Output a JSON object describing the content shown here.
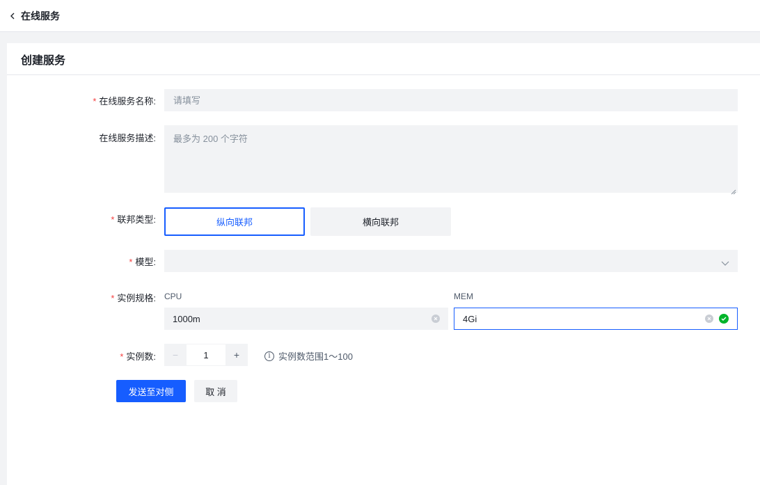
{
  "header": {
    "back_label": "在线服务"
  },
  "card": {
    "title": "创建服务"
  },
  "form": {
    "name": {
      "label": "在线服务名称:",
      "required": true,
      "placeholder": "请填写",
      "value": ""
    },
    "description": {
      "label": "在线服务描述:",
      "required": false,
      "placeholder": "最多为 200 个字符",
      "value": ""
    },
    "federation_type": {
      "label": "联邦类型:",
      "required": true,
      "options": [
        "纵向联邦",
        "横向联邦"
      ],
      "selected": "纵向联邦"
    },
    "model": {
      "label": "模型:",
      "required": true,
      "value": ""
    },
    "spec": {
      "label": "实例规格:",
      "required": true,
      "cpu_label": "CPU",
      "cpu_value": "1000m",
      "mem_label": "MEM",
      "mem_value": "4Gi"
    },
    "instances": {
      "label": "实例数:",
      "required": true,
      "value": "1",
      "minus": "−",
      "plus": "+",
      "hint": "实例数范围1～100"
    }
  },
  "actions": {
    "submit_label": "发送至对侧",
    "cancel_label": "取 消"
  },
  "colors": {
    "primary": "#165dff",
    "required": "#f53f3f",
    "success": "#00b42a"
  }
}
